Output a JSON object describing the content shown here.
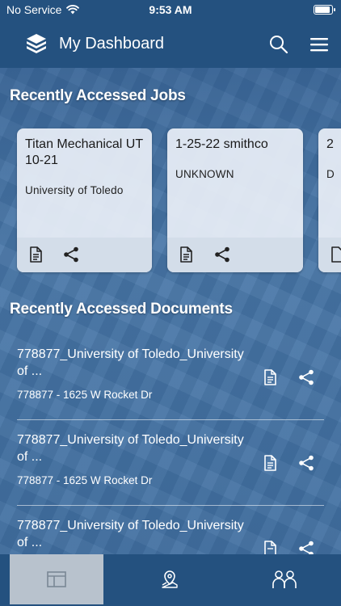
{
  "status_bar": {
    "carrier": "No Service",
    "time": "9:53 AM"
  },
  "header": {
    "title": "My Dashboard",
    "logo_icon": "cube-stack-icon",
    "search_icon": "search-icon",
    "menu_icon": "hamburger-menu-icon"
  },
  "jobs_section": {
    "title": "Recently Accessed Jobs",
    "cards": [
      {
        "title": "Titan Mechanical UT 10-21",
        "subtitle": "University of Toledo"
      },
      {
        "title": "1-25-22 smithco",
        "subtitle": "UNKNOWN"
      },
      {
        "title": "2",
        "subtitle": "D"
      }
    ]
  },
  "documents_section": {
    "title": "Recently Accessed Documents",
    "items": [
      {
        "title": "778877_University of Toledo_University of ...",
        "meta": "778877 - 1625 W Rocket Dr"
      },
      {
        "title": "778877_University of Toledo_University of ...",
        "meta": "778877 - 1625 W Rocket Dr"
      },
      {
        "title": "778877_University of Toledo_University of ...",
        "meta": ""
      }
    ]
  },
  "tab_bar": {
    "tabs": [
      {
        "icon": "dashboard-icon",
        "active": true
      },
      {
        "icon": "map-pin-icon",
        "active": false
      },
      {
        "icon": "people-icon",
        "active": false
      }
    ]
  },
  "colors": {
    "header_bg": "#24517f",
    "card_bg": "#e8eef6",
    "tab_active_bg": "#b8c2cd"
  }
}
